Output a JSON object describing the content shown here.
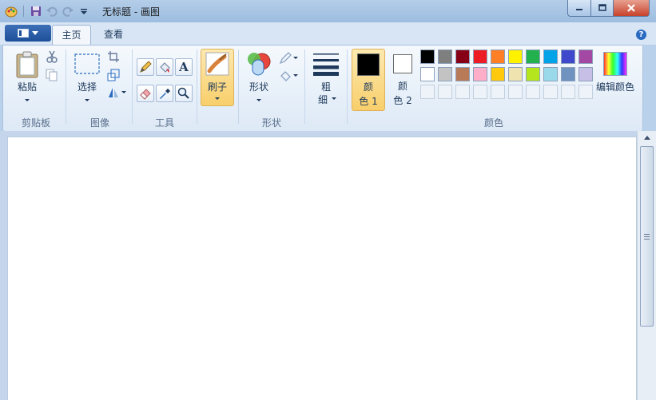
{
  "window": {
    "title": "无标题 - 画图"
  },
  "tabs": [
    {
      "label": "主页",
      "active": true
    },
    {
      "label": "查看",
      "active": false
    }
  ],
  "clipboard": {
    "paste_label": "粘贴",
    "group_label": "剪贴板"
  },
  "image": {
    "select_label": "选择",
    "group_label": "图像"
  },
  "tools": {
    "group_label": "工具"
  },
  "brushes": {
    "label": "刷子"
  },
  "shapes": {
    "label": "形状",
    "group_label": "形状"
  },
  "size": {
    "label_line1": "粗",
    "label_line2": "细"
  },
  "colors": {
    "group_label": "颜色",
    "color1_line1": "颜",
    "color1_line2": "色 1",
    "color2_line1": "颜",
    "color2_line2": "色 2",
    "edit_label": "编辑颜色",
    "color1_value": "#000000",
    "color2_value": "#ffffff",
    "palette_row1": [
      "#000000",
      "#7f7f7f",
      "#880015",
      "#ed1c24",
      "#ff7f27",
      "#fff200",
      "#22b14c",
      "#00a2e8",
      "#3f48cc",
      "#a349a4"
    ],
    "palette_row2": [
      "#ffffff",
      "#c3c3c3",
      "#b97a57",
      "#ffaec9",
      "#ffc90e",
      "#efe4b0",
      "#b5e61d",
      "#99d9ea",
      "#7092be",
      "#c8bfe7"
    ],
    "palette_row3": [
      "",
      "",
      "",
      "",
      "",
      "",
      "",
      "",
      "",
      ""
    ]
  },
  "accent": "#f8cf6b"
}
